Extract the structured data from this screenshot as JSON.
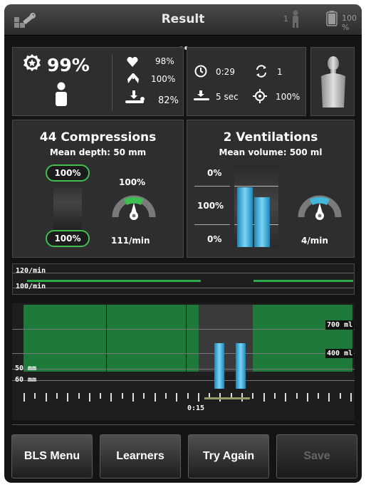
{
  "header": {
    "title": "Result",
    "learner_count": "1",
    "battery": "100 %",
    "icons": [
      "tools-icon",
      "person-icon",
      "battery-icon"
    ]
  },
  "pager": {
    "pages": 2,
    "active": 2
  },
  "overall": {
    "score": "99%",
    "heart_value": "98%",
    "lungs_value": "100%",
    "compression_value": "82%"
  },
  "timing": {
    "time": "0:29",
    "cycles": "1",
    "pause": "5 sec",
    "flow_fraction": "100%"
  },
  "compressions": {
    "title": "44 Compressions",
    "subtitle": "Mean depth: 50 mm",
    "depth_top": "100%",
    "depth_bottom": "100%",
    "rate_percent": "100%",
    "rate": "111/min",
    "gauge_level": 0.5
  },
  "ventilations": {
    "title": "2 Ventilations",
    "subtitle": "Mean volume: 500 ml",
    "levels": [
      "0%",
      "100%",
      "0%"
    ],
    "rate": "4/min",
    "bar_levels": [
      0.72,
      0.6
    ],
    "gauge_level": 0.5
  },
  "rate_chart": {
    "upper_label": "120/min",
    "lower_label": "100/min"
  },
  "timeline": {
    "volume_high": "700 ml",
    "volume_low": "400 ml",
    "depth_upper": "50 mm",
    "depth_lower": "60 mm",
    "time_label": "0:15"
  },
  "buttons": {
    "menu": "BLS Menu",
    "learners": "Learners",
    "try_again": "Try Again",
    "save": "Save"
  },
  "colors": {
    "green": "#2fa84a",
    "compression_fill": "#1e7a3a",
    "ventilation_blue": "#33aee0",
    "gauge_green": "#3fbf4f",
    "gauge_blue": "#44b6d8"
  }
}
